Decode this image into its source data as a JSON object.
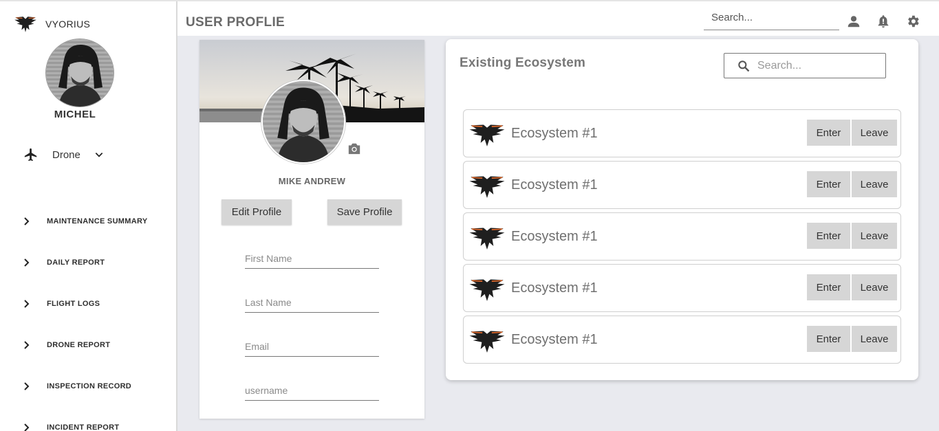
{
  "sidebar": {
    "brand_name": "VYORIUS",
    "user_name": "MICHEL",
    "drone_selector": {
      "label": "Drone",
      "icon": "airplane-icon"
    },
    "nav_items": [
      {
        "label": "MAINTENANCE SUMMARY"
      },
      {
        "label": "DAILY REPORT"
      },
      {
        "label": "FLIGHT LOGS"
      },
      {
        "label": "DRONE REPORT"
      },
      {
        "label": "INSPECTION RECORD"
      },
      {
        "label": "INCIDENT REPORT"
      }
    ]
  },
  "header": {
    "title": "USER PROFLIE",
    "search_placeholder": "Search...",
    "icons": [
      "person-icon",
      "bell-icon",
      "gear-icon"
    ]
  },
  "profile": {
    "name": "MIKE ANDREW",
    "edit_label": "Edit Profile",
    "save_label": "Save Profile",
    "fields": {
      "first_name": "First Name",
      "last_name": "Last Name",
      "email": "Email",
      "username": "username"
    }
  },
  "ecosystem": {
    "title": "Existing Ecosystem",
    "search_placeholder": "Search...",
    "items": [
      {
        "name": "Ecosystem #1",
        "enter": "Enter",
        "leave": "Leave"
      },
      {
        "name": "Ecosystem #1",
        "enter": "Enter",
        "leave": "Leave"
      },
      {
        "name": "Ecosystem #1",
        "enter": "Enter",
        "leave": "Leave"
      },
      {
        "name": "Ecosystem #1",
        "enter": "Enter",
        "leave": "Leave"
      },
      {
        "name": "Ecosystem #1",
        "enter": "Enter",
        "leave": "Leave"
      }
    ]
  },
  "colors": {
    "accent_orange": "#e06a2c",
    "button_gray": "#d6d6d6",
    "main_background": "#e9eaef"
  }
}
